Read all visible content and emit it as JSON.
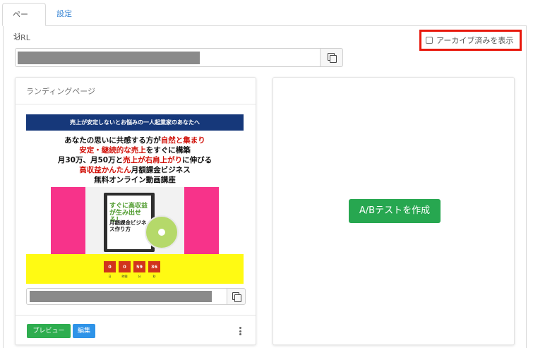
{
  "tabs": [
    {
      "label": "ページ",
      "active": true
    },
    {
      "label": "設定",
      "active": false
    }
  ],
  "url_section": {
    "label": "URL",
    "archive_toggle_label": "アーカイブ済みを表示",
    "archive_checked": false
  },
  "landing_card": {
    "title": "ランディングページ",
    "preview": {
      "banner": "売上が安定しないとお悩みの一人起業家のあなたへ",
      "line1_a": "あなたの思いに共感する方が",
      "line1_b": "自然と集まり",
      "line2_a": "安定・継続的な売上",
      "line2_b": "をすぐに構築",
      "line3_a": "月30万、月50万と",
      "line3_b": "売上が右肩上がり",
      "line3_c": "に伸びる",
      "line4_a": "高収益かんたん",
      "line4_b": "月額課金ビジネス",
      "line5": "無料オンライン動画講座",
      "product_text1": "すぐに高収益が生み出せる！",
      "product_text2": "月額課金ビジネス作り方",
      "timer": [
        "0",
        "0",
        "59",
        "36"
      ],
      "timer_labels": [
        "日",
        "時間",
        "分",
        "秒"
      ]
    },
    "preview_button": "プレビュー",
    "edit_button": "編集"
  },
  "ab_card": {
    "create_button": "A/Bテストを作成"
  },
  "colors": {
    "tab_link": "#3a86d4",
    "highlight_border": "#e8180c",
    "preview_green": "#2ead4f",
    "edit_blue": "#2e93e8",
    "ab_green": "#27a750",
    "redacted_gray": "#8a8a8a"
  }
}
